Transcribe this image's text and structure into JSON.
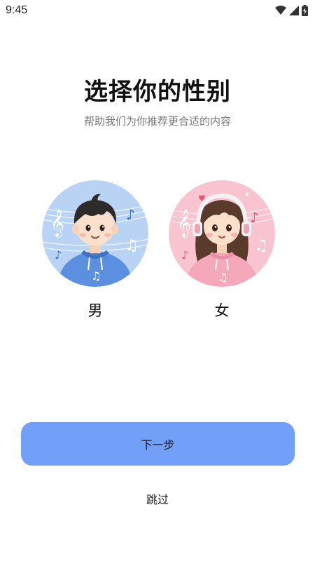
{
  "status_bar": {
    "time": "9:45",
    "icons": [
      "wifi-icon",
      "signal-icon",
      "battery-icon"
    ]
  },
  "page": {
    "title": "选择你的性别",
    "subtitle": "帮助我们为你推荐更合适的内容"
  },
  "options": [
    {
      "label": "男",
      "avatar": "boy-with-music-notes",
      "bg_color": "#b8d3f4"
    },
    {
      "label": "女",
      "avatar": "girl-with-headphones",
      "bg_color": "#f7c4cf"
    }
  ],
  "actions": {
    "next_label": "下一步",
    "skip_label": "跳过"
  },
  "colors": {
    "primary_button": "#729ff8",
    "subtitle_text": "#777777"
  }
}
